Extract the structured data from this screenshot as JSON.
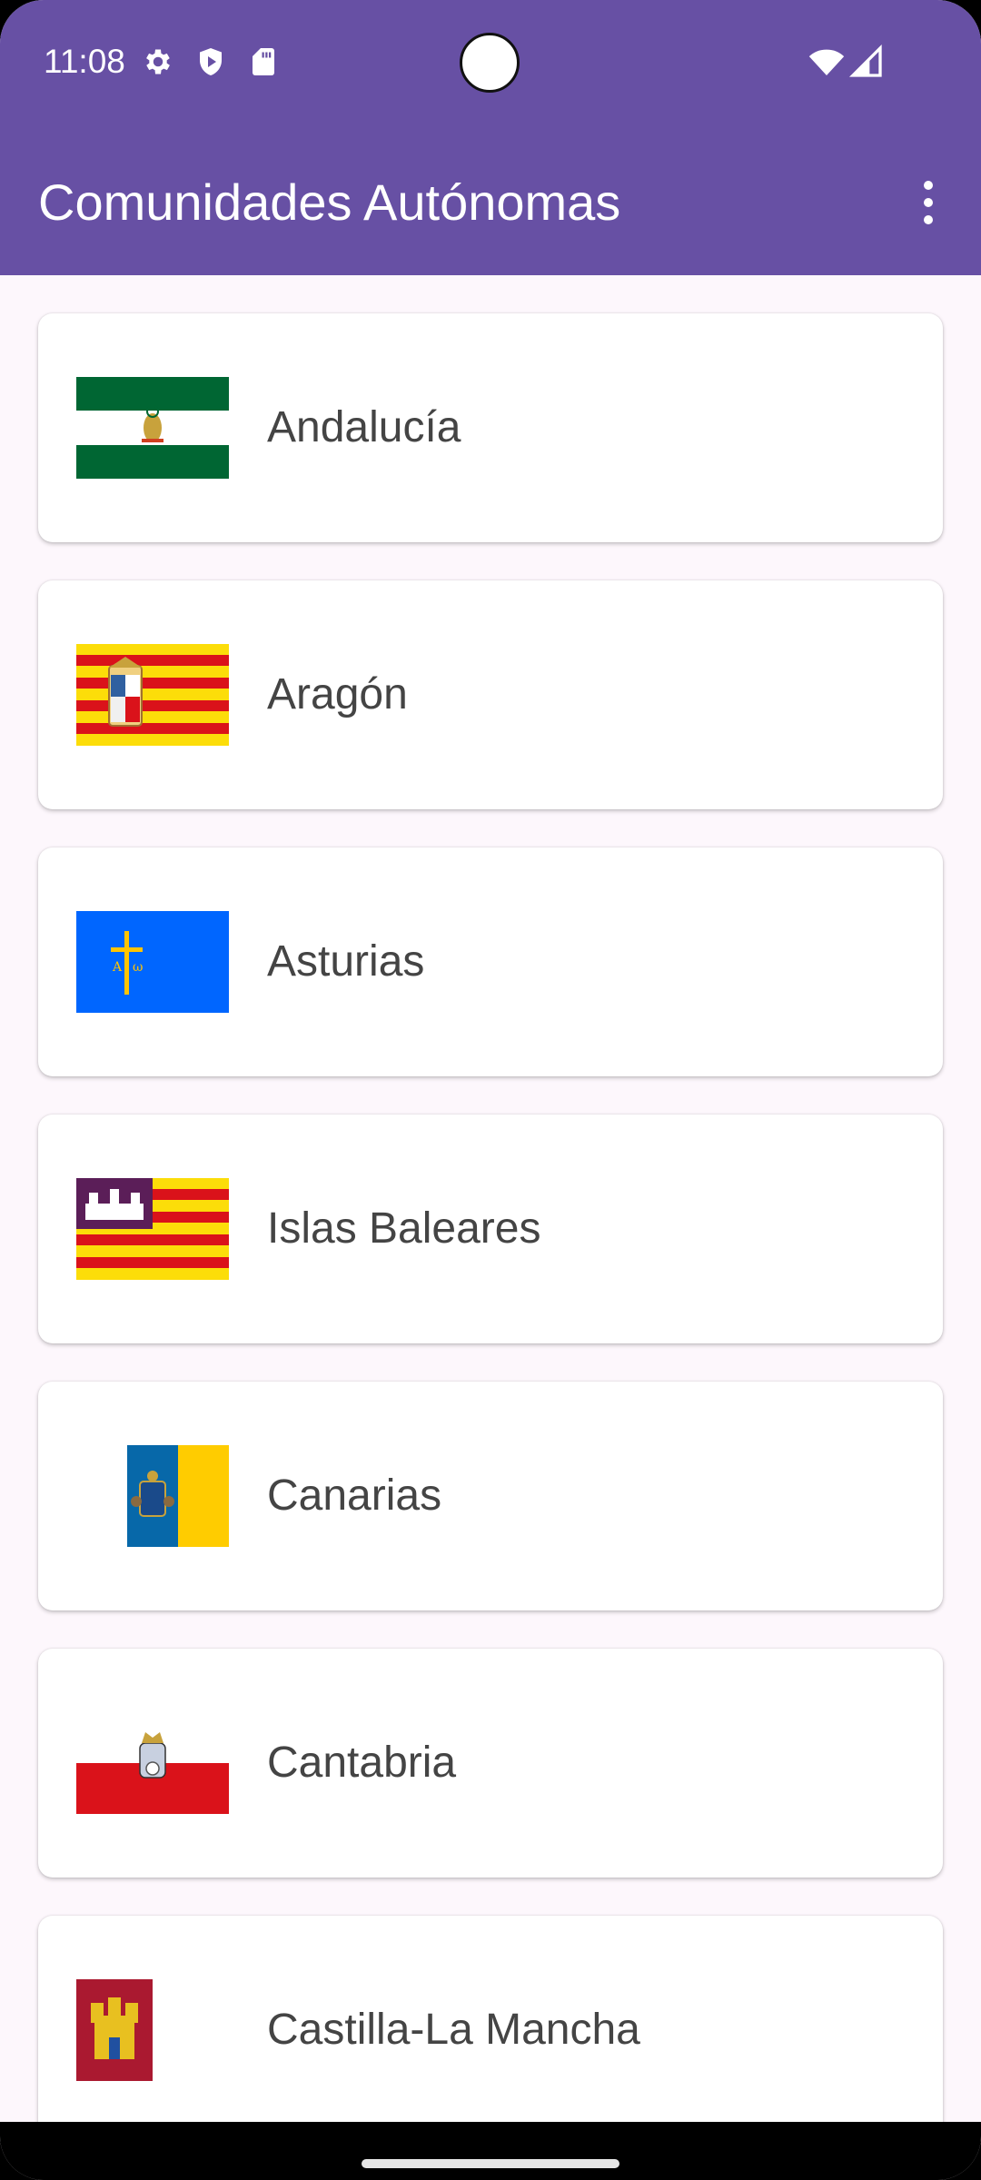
{
  "status_bar": {
    "time": "11:08",
    "icons": [
      "gear-icon",
      "shield-icon",
      "sd-card-icon",
      "wifi-icon",
      "signal-icon"
    ]
  },
  "app_bar": {
    "title": "Comunidades Autónomas",
    "menu_icon": "more-vert-icon",
    "color": "#6750a4"
  },
  "communities": [
    {
      "name": "Andalucía",
      "flag": "flag-andalucia-icon"
    },
    {
      "name": "Aragón",
      "flag": "flag-aragon-icon"
    },
    {
      "name": "Asturias",
      "flag": "flag-asturias-icon"
    },
    {
      "name": "Islas Baleares",
      "flag": "flag-baleares-icon"
    },
    {
      "name": "Canarias",
      "flag": "flag-canarias-icon"
    },
    {
      "name": "Cantabria",
      "flag": "flag-cantabria-icon"
    },
    {
      "name": "Castilla-La Mancha",
      "flag": "flag-castilla-la-mancha-icon"
    }
  ]
}
